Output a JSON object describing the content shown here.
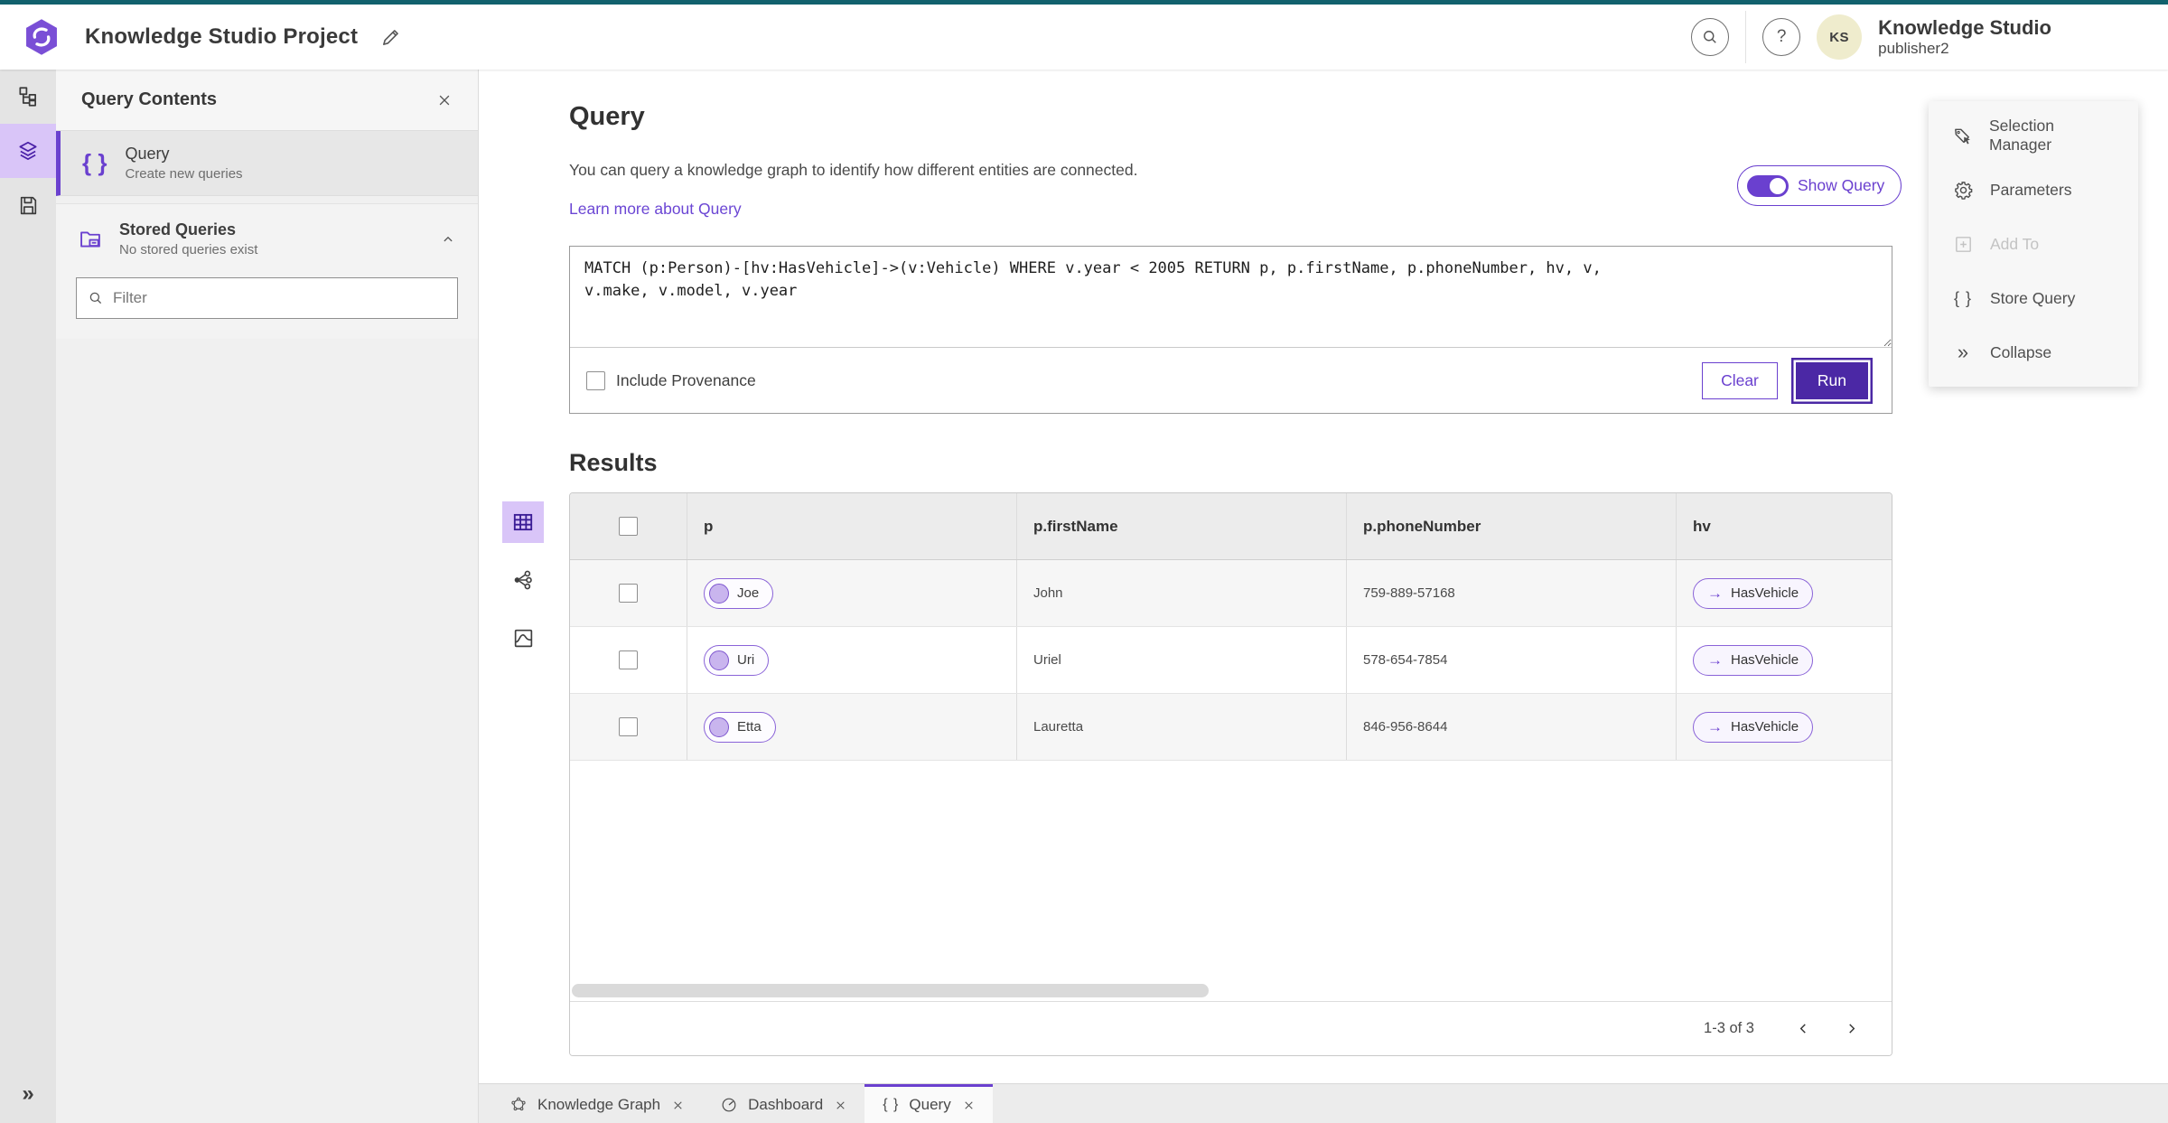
{
  "colors": {
    "accent": "#6a40cf",
    "accent_dark": "#4b28a5",
    "accent_soft": "#d9c5f8",
    "teal_bar": "#12616d",
    "avatar_bg": "#efeccd"
  },
  "app_bar": {
    "title": "Knowledge Studio Project",
    "account_name": "Knowledge Studio",
    "account_role": "publisher2",
    "avatar_initials": "KS"
  },
  "contents_panel": {
    "title": "Query Contents",
    "query_item": {
      "label": "Query",
      "description": "Create new queries"
    },
    "stored_queries": {
      "label": "Stored Queries",
      "description": "No stored queries exist"
    },
    "filter_placeholder": "Filter"
  },
  "query_section": {
    "title": "Query",
    "description": "You can query a knowledge graph to identify how different entities are connected.",
    "learn_more_label": "Learn more about Query",
    "show_query_label": "Show Query",
    "query_text": "MATCH (p:Person)-[hv:HasVehicle]->(v:Vehicle) WHERE v.year < 2005 RETURN p, p.firstName, p.phoneNumber, hv, v,\nv.make, v.model, v.year",
    "include_provenance_label": "Include Provenance",
    "clear_label": "Clear",
    "run_label": "Run"
  },
  "results_section": {
    "title": "Results",
    "columns": {
      "p": "p",
      "first_name": "p.firstName",
      "phone": "p.phoneNumber",
      "hv": "hv"
    },
    "rows": [
      {
        "p": "Joe",
        "first_name": "John",
        "phone": "759-889-57168",
        "hv": "HasVehicle"
      },
      {
        "p": "Uri",
        "first_name": "Uriel",
        "phone": "578-654-7854",
        "hv": "HasVehicle"
      },
      {
        "p": "Etta",
        "first_name": "Lauretta",
        "phone": "846-956-8644",
        "hv": "HasVehicle"
      }
    ],
    "pagination_label": "1-3 of 3"
  },
  "tools_panel": {
    "selection_manager": "Selection Manager",
    "parameters": "Parameters",
    "add_to": "Add To",
    "store_query": "Store Query",
    "collapse": "Collapse"
  },
  "bottom_tabs": [
    {
      "label": "Knowledge Graph"
    },
    {
      "label": "Dashboard"
    },
    {
      "label": "Query"
    }
  ],
  "glyphs": {
    "braces": "{ }",
    "arrow_right": "→",
    "collapse_chevrons": "»",
    "question_mark": "?"
  }
}
